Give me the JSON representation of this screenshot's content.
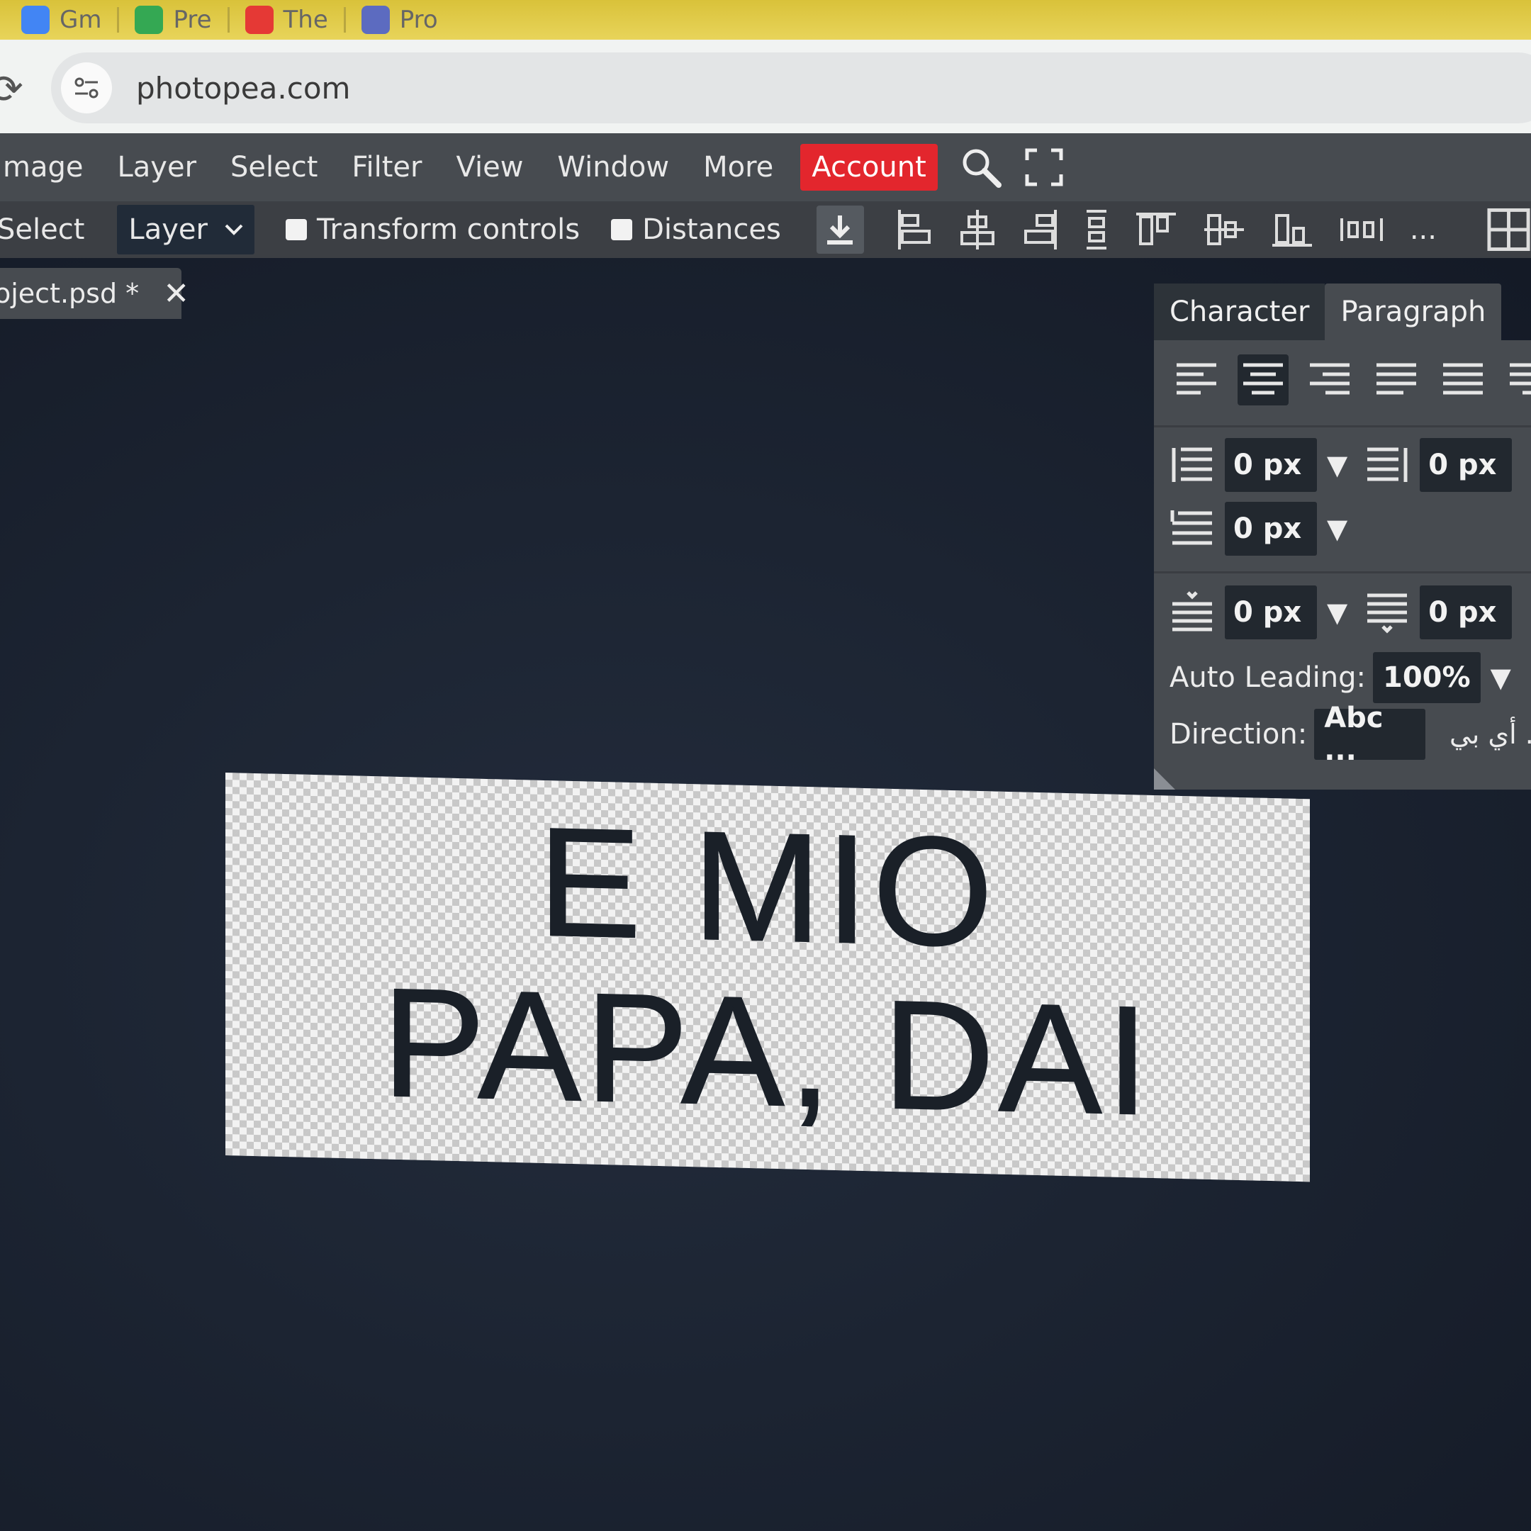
{
  "bookmarks": {
    "items": [
      {
        "label": "Gm",
        "color": "#4285f4",
        "icon": "google-icon"
      },
      {
        "label": "Pre",
        "color": "#34a853",
        "icon": "slides-icon"
      },
      {
        "label": "The",
        "color": "#e53935",
        "icon": "target-icon"
      },
      {
        "label": "Pro",
        "color": "#5c6bc0",
        "icon": "lightning-icon"
      }
    ]
  },
  "browser": {
    "url": "photopea.com"
  },
  "menu": {
    "items": [
      "mage",
      "Layer",
      "Select",
      "Filter",
      "View",
      "Window",
      "More"
    ],
    "account": "Account"
  },
  "toolbar": {
    "select_label": "Select",
    "layer_dropdown": "Layer",
    "transform_controls": "Transform controls",
    "distances": "Distances",
    "more": "..."
  },
  "document_tab": {
    "name": "oject.psd *",
    "close": "✕"
  },
  "canvas": {
    "line1": "E MIO",
    "line2": "PAPA, DAI"
  },
  "panel": {
    "tabs": [
      "Character",
      "Paragraph"
    ],
    "active_tab": "Paragraph",
    "indent_left": "0 px",
    "indent_right": "0 px",
    "indent_first": "0 px",
    "space_before": "0 px",
    "space_after": "0 px",
    "auto_leading_label": "Auto Leading:",
    "auto_leading_value": "100%",
    "direction_label": "Direction:",
    "direction_ltr": "Abc ...",
    "direction_rtl": "أي بي ..."
  },
  "colors": {
    "account": "#e3262d",
    "menubar": "#474b50",
    "toolbar": "#3c3f44",
    "workspace": "#1b2230"
  }
}
